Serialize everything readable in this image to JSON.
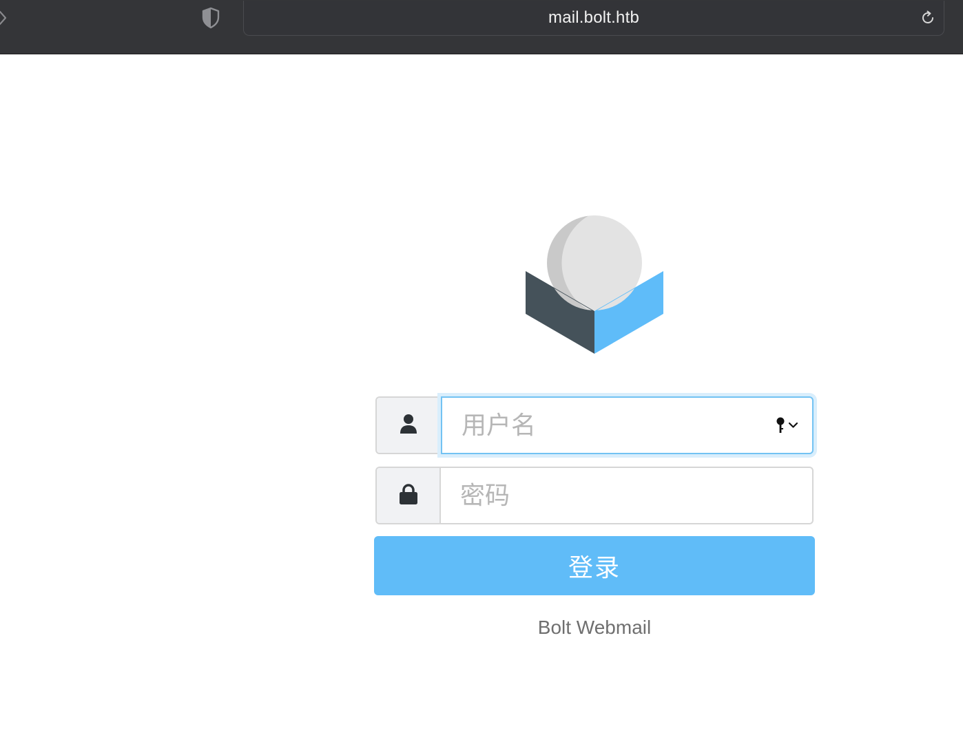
{
  "browser": {
    "url": "mail.bolt.htb",
    "icons": {
      "forward": "chevron-right-icon",
      "shield": "shield-icon",
      "reload": "reload-icon"
    }
  },
  "login": {
    "logo": "roundcube-logo",
    "username_placeholder": "用户名",
    "password_placeholder": "密码",
    "submit_label": "登录",
    "footer_text": "Bolt Webmail",
    "icons": {
      "user": "user-icon",
      "lock": "lock-icon",
      "keychain": "key-icon"
    }
  },
  "colors": {
    "toolbar_bg": "#343538",
    "accent": "#60bcf8",
    "focus_border": "#72c2f3",
    "logo_dark": "#45525a",
    "logo_blue": "#5fbcf9",
    "logo_sphere": "#e3e3e3"
  }
}
